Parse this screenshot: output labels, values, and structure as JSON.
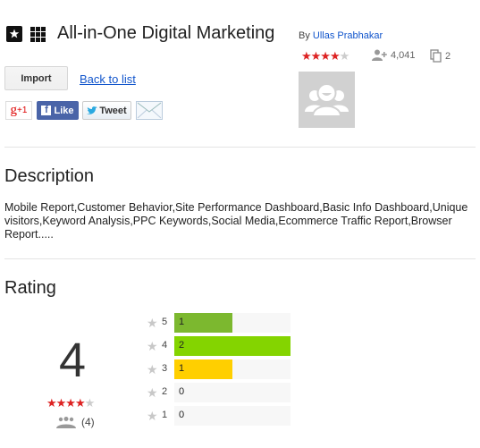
{
  "header": {
    "title": "All-in-One Digital Marketing",
    "by_label": "By",
    "author": "Ullas Prabhakar",
    "rating_stars": 4,
    "max_stars": 5,
    "users_count": "4,041",
    "copies_count": "2"
  },
  "actions": {
    "import_label": "Import",
    "back_label": "Back to list"
  },
  "share": {
    "gplus_label": "+1",
    "gplus_glyph": "g",
    "facebook_label": "Like",
    "twitter_label": "Tweet"
  },
  "description": {
    "heading": "Description",
    "text": "Mobile Report,Customer Behavior,Site Performance Dashboard,Basic Info Dashboard,Unique visitors,Keyword Analysis,PPC Keywords,Social Media,Ecommerce Traffic Report,Browser Report....."
  },
  "rating": {
    "heading": "Rating",
    "average": "4",
    "stars": 4,
    "raters": "(4)",
    "histogram": [
      {
        "stars": "5",
        "count": 1,
        "label": "1",
        "color": "#7cb82f"
      },
      {
        "stars": "4",
        "count": 2,
        "label": "2",
        "color": "#84d400"
      },
      {
        "stars": "3",
        "count": 1,
        "label": "1",
        "color": "#ffcf00"
      },
      {
        "stars": "2",
        "count": 0,
        "label": "0",
        "color": "#cccccc"
      },
      {
        "stars": "1",
        "count": 0,
        "label": "0",
        "color": "#cccccc"
      }
    ],
    "max_count": 2
  },
  "colors": {
    "link": "#1155cc",
    "star_on": "#dd2222",
    "star_off": "#cccccc"
  }
}
